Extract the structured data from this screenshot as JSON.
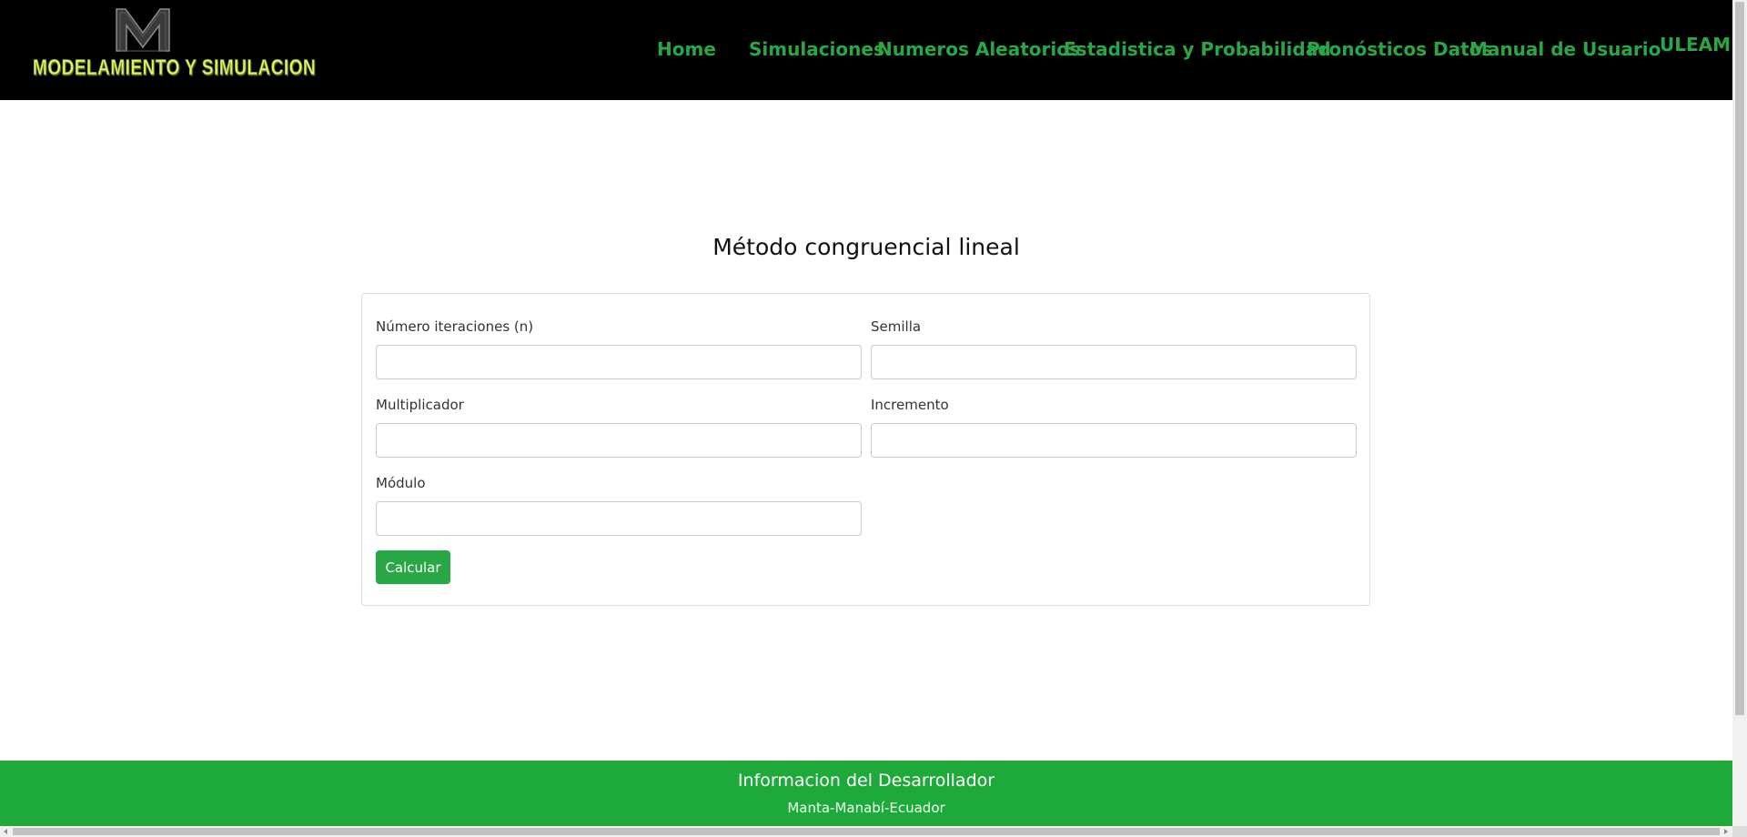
{
  "header": {
    "logo_text": "MODELAMIENTO Y SIMULACION",
    "logo_mark_icon": "m-letter-logo-icon",
    "nav": [
      {
        "label": "Home"
      },
      {
        "label": "Simulaciones"
      },
      {
        "label": "Numeros Aleatorios"
      },
      {
        "label": "Estadistica y Probabilidad"
      },
      {
        "label": "Pronósticos Datos"
      },
      {
        "label": "Manual de Usuario"
      },
      {
        "label": "ULEAM"
      }
    ]
  },
  "main": {
    "title": "Método congruencial lineal",
    "fields": {
      "iteraciones": {
        "label": "Número iteraciones (n)",
        "value": ""
      },
      "semilla": {
        "label": "Semilla",
        "value": ""
      },
      "multiplicador": {
        "label": "Multiplicador",
        "value": ""
      },
      "incremento": {
        "label": "Incremento",
        "value": ""
      },
      "modulo": {
        "label": "Módulo",
        "value": ""
      }
    },
    "calc_button": "Calcular"
  },
  "footer": {
    "title": "Informacion del Desarrollador",
    "location": "Manta-Manabí-Ecuador"
  },
  "colors": {
    "header_bg": "#000000",
    "nav_text": "#28a745",
    "button_bg": "#28a745",
    "footer_bg": "#1eaa3a",
    "logo_text": "#e6f06a"
  }
}
